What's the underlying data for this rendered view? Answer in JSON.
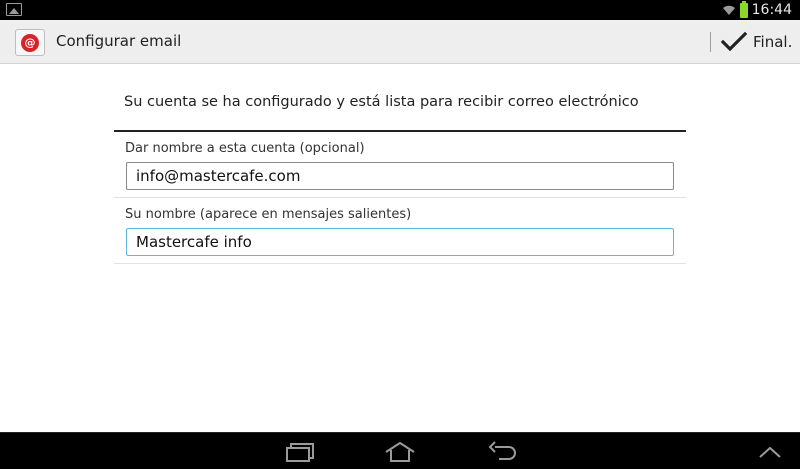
{
  "status_bar": {
    "time": "16:44",
    "left_icon": "image-icon",
    "wifi_icon": "wifi-icon",
    "battery_icon": "battery-icon",
    "battery_color": "#8ad82a"
  },
  "action_bar": {
    "title": "Configurar email",
    "app_icon": "email-at-icon",
    "app_icon_color": "#d8232a",
    "done_icon": "check-icon",
    "done_label": "Final."
  },
  "content": {
    "message": "Su cuenta se ha configurado y está lista para recibir correo electrónico",
    "fields": [
      {
        "label": "Dar nombre a esta cuenta (opcional)",
        "value": "info@mastercafe.com"
      },
      {
        "label": "Su nombre (aparece en mensajes salientes)",
        "value": "Mastercafe info",
        "focused": true,
        "focus_color": "#5fb6d8"
      }
    ]
  },
  "nav_bar": {
    "recent_icon": "recent-apps-icon",
    "home_icon": "home-icon",
    "back_icon": "back-icon",
    "expand_icon": "chevron-up-icon"
  }
}
